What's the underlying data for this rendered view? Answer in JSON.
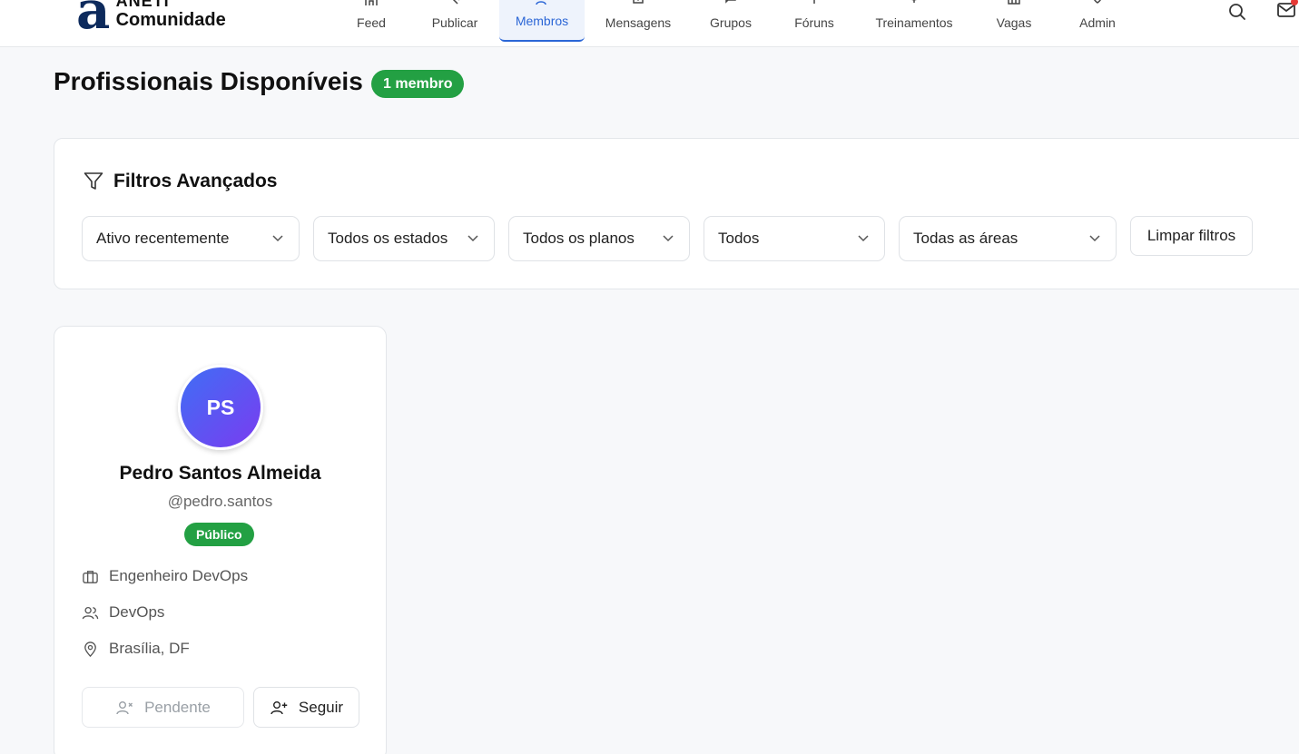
{
  "header": {
    "logo_top": "ANETI",
    "logo_bottom": "Comunidade",
    "nav": [
      {
        "label": "Feed",
        "icon": "home-icon",
        "active": false
      },
      {
        "label": "Publicar",
        "icon": "edit-icon",
        "active": false
      },
      {
        "label": "Membros",
        "icon": "users-icon",
        "active": true
      },
      {
        "label": "Mensagens",
        "icon": "inbox-icon",
        "active": false
      },
      {
        "label": "Grupos",
        "icon": "chat-icon",
        "active": false
      },
      {
        "label": "Fóruns",
        "icon": "book-icon",
        "active": false
      },
      {
        "label": "Treinamentos",
        "icon": "graduation-icon",
        "active": false
      },
      {
        "label": "Vagas",
        "icon": "briefcase-icon",
        "active": false
      },
      {
        "label": "Admin",
        "icon": "shield-icon",
        "active": false
      }
    ],
    "accent": "#2b66d6"
  },
  "page": {
    "title": "Profissionais Disponíveis",
    "count_badge": "1 membro"
  },
  "filters": {
    "title": "Filtros Avançados",
    "selects": [
      {
        "value": "Ativo recentemente"
      },
      {
        "value": "Todos os estados"
      },
      {
        "value": "Todos os planos"
      },
      {
        "value": "Todos"
      },
      {
        "value": "Todas as áreas"
      }
    ],
    "clear_label": "Limpar filtros"
  },
  "members": [
    {
      "initials": "PS",
      "name": "Pedro Santos Almeida",
      "handle": "@pedro.santos",
      "visibility": "Público",
      "role": "Engenheiro DevOps",
      "area": "DevOps",
      "location": "Brasília, DF",
      "pending_label": "Pendente",
      "follow_label": "Seguir"
    }
  ],
  "colors": {
    "badge_green": "#23a043",
    "avatar_gradient_start": "#3f6ef5",
    "avatar_gradient_end": "#7a3cf0"
  }
}
